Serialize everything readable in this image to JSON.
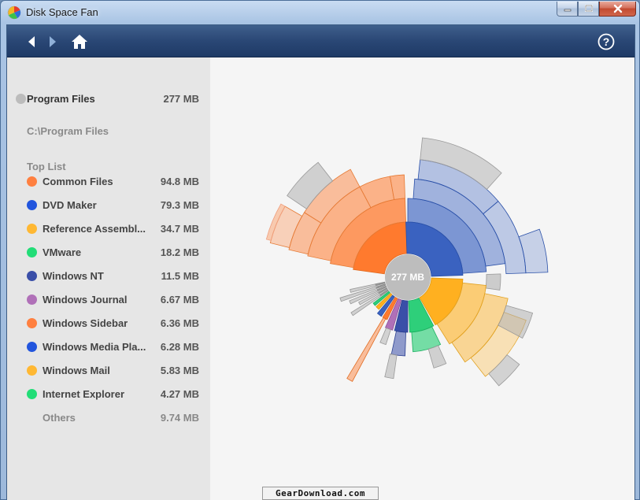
{
  "window": {
    "title": "Disk Space Fan",
    "controls": {
      "minimize": "minimize-icon",
      "maximize": "maximize-icon",
      "close": "close-icon"
    }
  },
  "toolbar": {
    "back": "arrow-left-icon",
    "forward": "arrow-right-icon",
    "home": "home-icon",
    "help_label": "?"
  },
  "sidebar": {
    "folder": {
      "name": "Program Files",
      "size": "277 MB",
      "color": "#bcbcbc"
    },
    "path": "C:\\Program Files",
    "top_list_label": "Top List",
    "items": [
      {
        "name": "Common Files",
        "size": "94.8 MB",
        "color": "#ff8040"
      },
      {
        "name": "DVD Maker",
        "size": "79.3 MB",
        "color": "#2255dd"
      },
      {
        "name": "Reference Assembl...",
        "size": "34.7 MB",
        "color": "#ffb833"
      },
      {
        "name": "VMware",
        "size": "18.2 MB",
        "color": "#22dd77"
      },
      {
        "name": "Windows NT",
        "size": "11.5 MB",
        "color": "#3a4fa8"
      },
      {
        "name": "Windows Journal",
        "size": "6.67 MB",
        "color": "#b070b8"
      },
      {
        "name": "Windows Sidebar",
        "size": "6.36 MB",
        "color": "#ff8040"
      },
      {
        "name": "Windows Media Pla...",
        "size": "6.28 MB",
        "color": "#2255dd"
      },
      {
        "name": "Windows Mail",
        "size": "5.83 MB",
        "color": "#ffb833"
      },
      {
        "name": "Internet Explorer",
        "size": "4.27 MB",
        "color": "#22dd77"
      }
    ],
    "others": {
      "name": "Others",
      "size": "9.74 MB"
    }
  },
  "chart": {
    "center_label": "277 MB",
    "center_color": "#bdbdbd",
    "gray_color": "#c8c8c8"
  },
  "watermark": "GearDownload.com"
}
